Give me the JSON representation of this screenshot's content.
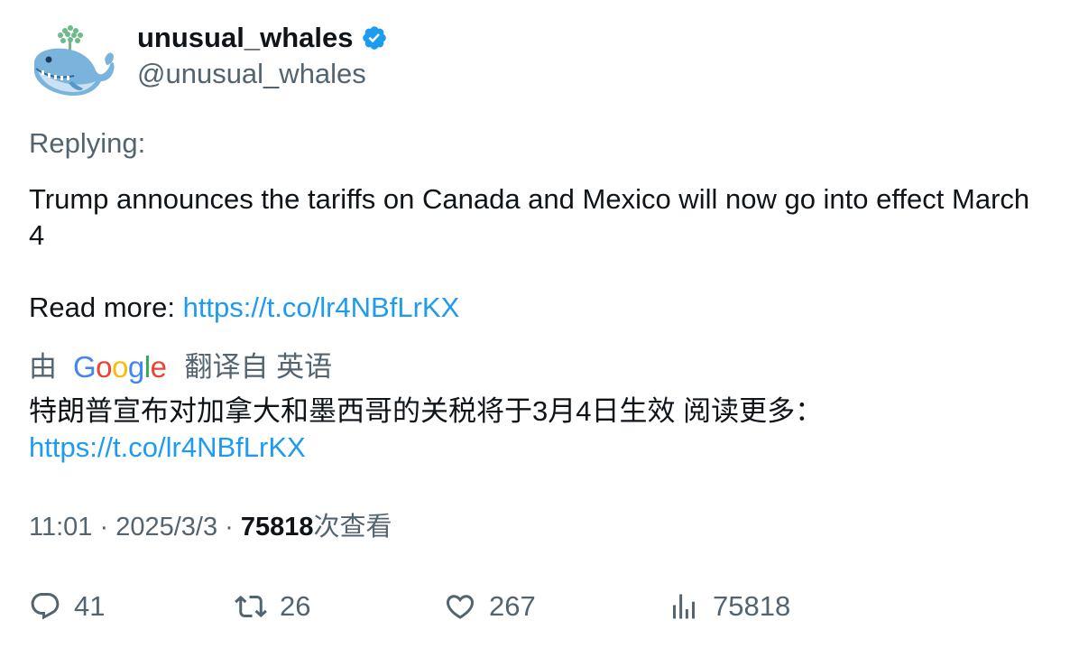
{
  "user": {
    "display_name": "unusual_whales",
    "handle": "@unusual_whales",
    "verified_color": "#1d9bf0"
  },
  "tweet": {
    "replying_label": "Replying:",
    "text_line": "Trump announces the tariffs on Canada and Mexico will now go into effect March 4",
    "read_more_label": "Read more: ",
    "link": "https://t.co/lr4NBfLrKX"
  },
  "translation": {
    "by_label": "由",
    "google_label": "Google",
    "from_label": "翻译自 英语",
    "text": "特朗普宣布对加拿大和墨西哥的关税将于3月4日生效 阅读更多：",
    "link": "https://t.co/lr4NBfLrKX"
  },
  "meta": {
    "time": "11:01",
    "separator": " · ",
    "date": "2025/3/3",
    "views_count": "75818",
    "views_label": "次查看"
  },
  "actions": {
    "replies": "41",
    "retweets": "26",
    "likes": "267",
    "views": "75818"
  },
  "colors": {
    "link": "#1d9bf0",
    "muted": "#536471",
    "text": "#0f1419"
  }
}
